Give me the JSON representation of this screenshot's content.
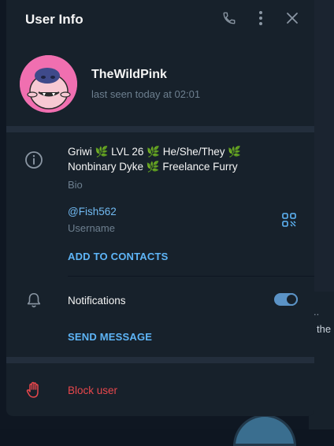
{
  "window": {
    "title": "User Info"
  },
  "header": {
    "call_icon": "phone-icon",
    "menu_icon": "more-vertical-icon",
    "close_icon": "close-icon"
  },
  "profile": {
    "name": "TheWildPink",
    "last_seen": "last seen today at 02:01",
    "avatar_icon": "pink-creature-avatar"
  },
  "info": {
    "icon": "info-icon",
    "bio_line1_parts": [
      "Griwi",
      "LVL 26",
      "He/She/They",
      ""
    ],
    "bio_line2_parts": [
      "Nonbinary Dyke",
      "Freelance Furry"
    ],
    "leaf_glyph": "🌿",
    "bio_label": "Bio",
    "username": "@Fish562",
    "username_label": "Username",
    "qr_icon": "qr-code-icon",
    "add_to_contacts": "ADD TO CONTACTS"
  },
  "notifications": {
    "icon": "bell-icon",
    "label": "Notifications",
    "enabled": true,
    "send_message": "SEND MESSAGE"
  },
  "block": {
    "icon": "stop-hand-icon",
    "label": "Block user"
  },
  "background": {
    "text1": "..",
    "text2": "the"
  },
  "colors": {
    "dialog_bg": "#17212b",
    "accent": "#5eb5f7",
    "danger": "#e8474c",
    "muted": "#6d7f8f"
  }
}
